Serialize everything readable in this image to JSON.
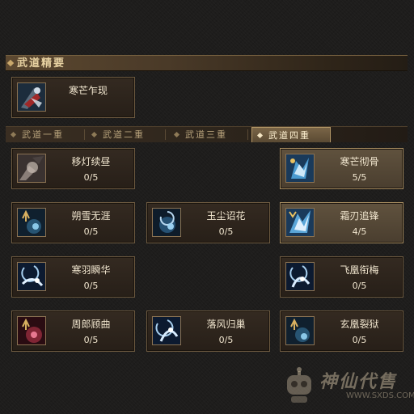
{
  "section": {
    "title": "武道精要"
  },
  "main_skill": {
    "name": "寒芒乍现"
  },
  "tabs": [
    {
      "label": "武道一重",
      "active": false
    },
    {
      "label": "武道二重",
      "active": false
    },
    {
      "label": "武道三重",
      "active": false
    },
    {
      "label": "武道四重",
      "active": true
    }
  ],
  "skills": [
    {
      "name": "移灯续昼",
      "count": "0/5",
      "icon": "sword-strike-icon",
      "highlighted": false
    },
    {
      "name": "寒芒彻骨",
      "count": "5/5",
      "icon": "frost-burst-icon",
      "highlighted": true
    },
    {
      "name": "朔雪无涯",
      "count": "0/5",
      "icon": "blue-rune-icon",
      "highlighted": false
    },
    {
      "name": "玉尘诏花",
      "count": "0/5",
      "icon": "frost-moon-icon",
      "highlighted": false
    },
    {
      "name": "霜刃追锋",
      "count": "4/5",
      "icon": "frost-burst-icon",
      "highlighted": true
    },
    {
      "name": "寒羽瞬华",
      "count": "0/5",
      "icon": "crescent-wave-icon",
      "highlighted": false
    },
    {
      "name": "飞凰衔梅",
      "count": "0/5",
      "icon": "crescent-wave-icon",
      "highlighted": false
    },
    {
      "name": "周郎顾曲",
      "count": "0/5",
      "icon": "red-rune-icon",
      "highlighted": false
    },
    {
      "name": "落风归巢",
      "count": "0/5",
      "icon": "crescent-wave-icon",
      "highlighted": false
    },
    {
      "name": "玄凰裂狱",
      "count": "0/5",
      "icon": "blue-rune-icon",
      "highlighted": false
    }
  ],
  "watermark": {
    "text": "神仙代售",
    "url": "WWW.SXDS.COM"
  },
  "colors": {
    "gold": "#e8d2a2",
    "highlight": "#60523e",
    "card": "#342a21"
  }
}
